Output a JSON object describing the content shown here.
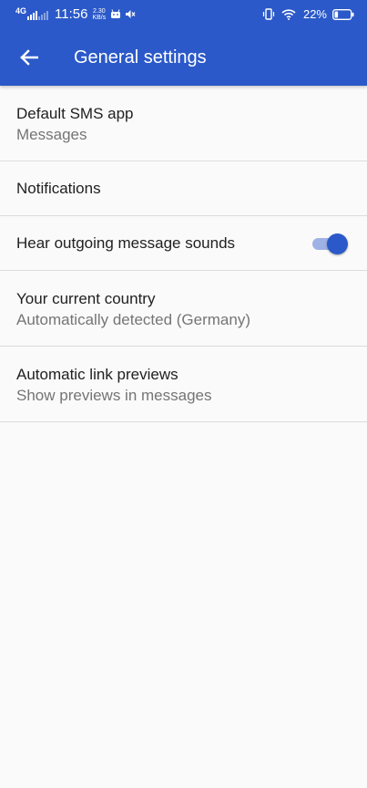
{
  "status_bar": {
    "network_type": "4G",
    "time": "11:56",
    "speed_value": "2.30",
    "speed_unit": "KB/s",
    "battery_percent": "22%"
  },
  "app_bar": {
    "title": "General settings",
    "back_icon": "arrow-left-icon",
    "color": "#2b59c9"
  },
  "settings": {
    "default_sms": {
      "title": "Default SMS app",
      "subtitle": "Messages"
    },
    "notifications": {
      "title": "Notifications"
    },
    "outgoing_sounds": {
      "title": "Hear outgoing message sounds",
      "enabled": true
    },
    "country": {
      "title": "Your current country",
      "subtitle": "Automatically detected (Germany)"
    },
    "link_previews": {
      "title": "Automatic link previews",
      "subtitle": "Show previews in messages"
    }
  }
}
